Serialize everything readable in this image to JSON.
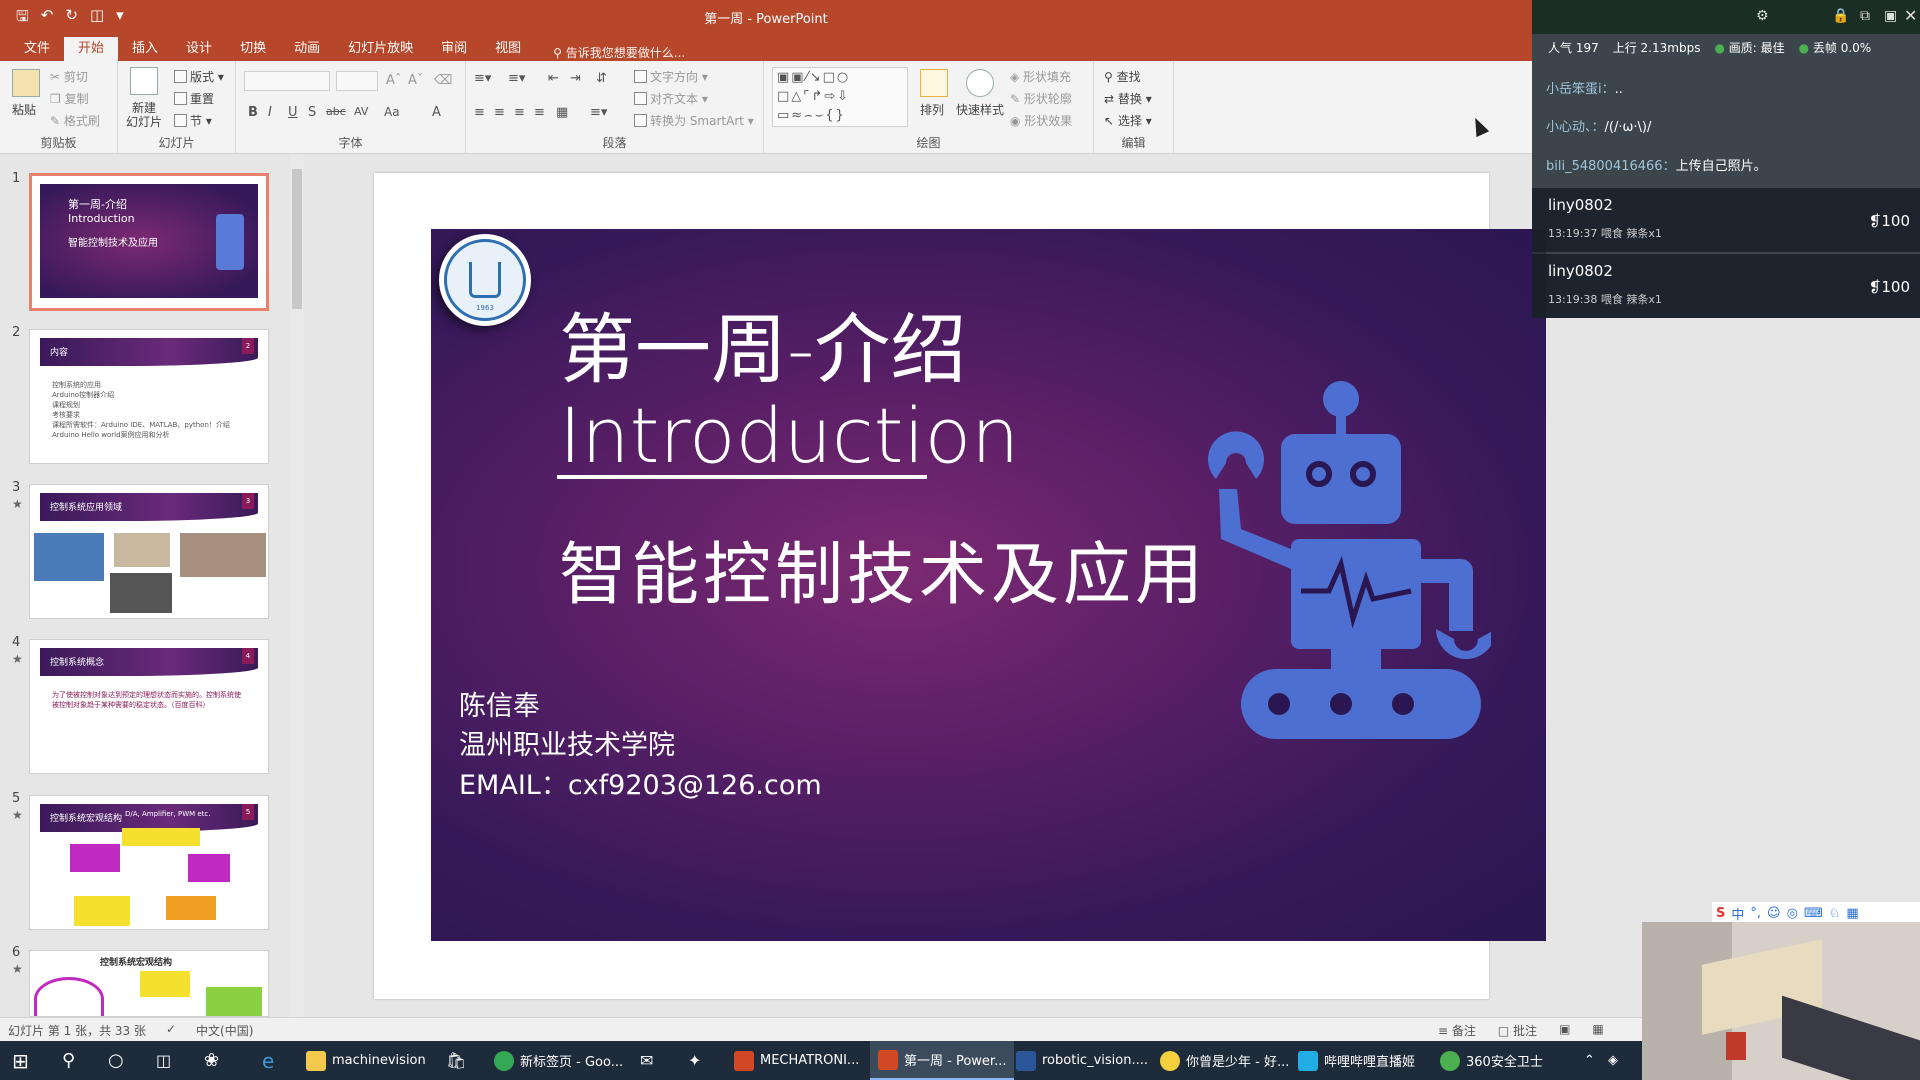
{
  "window": {
    "title": "第一周 - PowerPoint",
    "qat": [
      "save",
      "undo",
      "redo",
      "start-from-beginning",
      "customize"
    ]
  },
  "tabs": {
    "items": [
      "文件",
      "开始",
      "插入",
      "设计",
      "切换",
      "动画",
      "幻灯片放映",
      "审阅",
      "视图"
    ],
    "active": "开始",
    "tell_me": "告诉我您想要做什么..."
  },
  "ribbon": {
    "clipboard": {
      "label": "剪贴板",
      "paste": "粘贴",
      "cut": "剪切",
      "copy": "复制",
      "format_painter": "格式刷"
    },
    "slides": {
      "label": "幻灯片",
      "new_slide": "新建\n幻灯片",
      "layout": "版式",
      "reset": "重置",
      "section": "节"
    },
    "font": {
      "label": "字体",
      "buttons": [
        "B",
        "I",
        "U",
        "S",
        "abc",
        "AV",
        "Aa",
        "A"
      ]
    },
    "paragraph": {
      "label": "段落",
      "text_direction": "文字方向",
      "align_text": "对齐文本",
      "smartart": "转换为 SmartArt"
    },
    "drawing": {
      "label": "绘图",
      "arrange": "排列",
      "quick_styles": "快速样式",
      "shape_fill": "形状填充",
      "shape_outline": "形状轮廓",
      "shape_effects": "形状效果"
    },
    "editing": {
      "label": "编辑",
      "find": "查找",
      "replace": "替换",
      "select": "选择"
    }
  },
  "thumbnails": [
    {
      "num": "1",
      "star": "",
      "title": "第一周-介绍\nIntroduction",
      "subtitle": "智能控制技术及应用",
      "selected": true
    },
    {
      "num": "2",
      "star": "",
      "title": "内容",
      "lines": [
        "控制系统的应用",
        "Arduino控制器介绍",
        "课程规划",
        "考核要求",
        "课程所需软件：Arduino IDE、MATLAB、python！介绍",
        "Arduino Hello world案例应用和分析"
      ]
    },
    {
      "num": "3",
      "star": "★",
      "title": "控制系统应用领域"
    },
    {
      "num": "4",
      "star": "★",
      "title": "控制系统概念",
      "lines": [
        "为了使被控制对象达到预定的理想状态而实施的。控制系统使被控制对象趋于某种需要的稳定状态。（百度百科）"
      ]
    },
    {
      "num": "5",
      "star": "★",
      "title": "控制系统宏观结构",
      "extra": "D/A, Amplifier, PWM etc."
    },
    {
      "num": "6",
      "star": "★",
      "title": "控制系统宏观结构"
    }
  ],
  "slide": {
    "title_line1": "第一周-介绍",
    "title_line2": "Introduction",
    "subtitle": "智能控制技术及应用",
    "author": "陈信奉",
    "school": "温州职业技术学院",
    "email": "EMAIL：cxf9203@126.com",
    "logo_year": "1963"
  },
  "statusbar": {
    "slide_info": "幻灯片 第 1 张，共 33 张",
    "language": "中文(中国)",
    "notes": "备注",
    "comments": "批注"
  },
  "taskbar": {
    "items": [
      {
        "label": "machinevision",
        "color": "#f2c94c"
      },
      {
        "label": "新标签页 - Goo...",
        "color": "#34a853"
      },
      {
        "label": "MECHATRONI...",
        "color": "#d24726"
      },
      {
        "label": "第一周 - Power...",
        "color": "#d24726",
        "active": true
      },
      {
        "label": "robotic_vision....",
        "color": "#2b579a"
      },
      {
        "label": "你曾是少年 - 好...",
        "color": "#f4d03f"
      },
      {
        "label": "哔哩哔哩直播姬",
        "color": "#23ade5"
      },
      {
        "label": "360安全卫士",
        "color": "#4caf50"
      }
    ]
  },
  "live": {
    "popularity": "人气  197",
    "upload": "上行  2.13mbps",
    "quality": "画质: 最佳",
    "loss": "丢帧 0.0%",
    "chats": [
      {
        "user": "小岳笨蛋i：",
        "msg": ".."
      },
      {
        "user": "小心动、：",
        "msg": "/(/·ω·\\)/"
      },
      {
        "user": "bili_54800416466：",
        "msg": "上传自己照片。"
      }
    ],
    "gifts": [
      {
        "user": "liny0802",
        "time": "13:19:37",
        "action": "喂食",
        "item": "辣条x1",
        "count": "100"
      },
      {
        "user": "liny0802",
        "time": "13:19:38",
        "action": "喂食",
        "item": "辣条x1",
        "count": "100"
      }
    ]
  },
  "ime": {
    "label": "中"
  }
}
